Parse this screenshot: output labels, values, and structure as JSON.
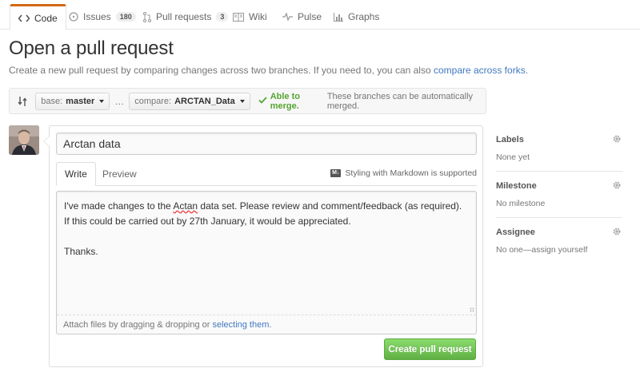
{
  "tabs": [
    {
      "label": "Code",
      "icon": "code-icon",
      "selected": true
    },
    {
      "label": "Issues",
      "icon": "issue-icon",
      "count": "180"
    },
    {
      "label": "Pull requests",
      "icon": "pull-request-icon",
      "count": "3"
    },
    {
      "label": "Wiki",
      "icon": "book-icon"
    },
    {
      "label": "Pulse",
      "icon": "pulse-icon"
    },
    {
      "label": "Graphs",
      "icon": "graph-icon"
    }
  ],
  "page": {
    "title": "Open a pull request",
    "subtitle": "Create a new pull request by comparing changes across two branches. If you need to, you can also ",
    "subtitle_link": "compare across forks",
    "subtitle_end": "."
  },
  "range": {
    "base_prefix": "base:",
    "base_branch": "master",
    "dots": "…",
    "compare_prefix": "compare:",
    "compare_branch": "ARCTAN_Data",
    "merge_ok": "Able to merge.",
    "merge_text": "These branches can be automatically merged."
  },
  "form": {
    "title_value": "Arctan data",
    "write_tab": "Write",
    "preview_tab": "Preview",
    "markdown_hint": "Styling with Markdown is supported",
    "markdown_badge": "M↓",
    "body_part1": "I've made changes to the ",
    "body_misspelled": "Actan",
    "body_part2": " data set. Please review and comment/feedback (as required). If this could be carried out by 27th January, it would be appreciated.\n\nThanks.",
    "attach_text": "Attach files by dragging & dropping or",
    "attach_link": "selecting them",
    "attach_end": ".",
    "submit_label": "Create pull request"
  },
  "sidebar": {
    "labels": {
      "heading": "Labels",
      "value": "None yet"
    },
    "milestone": {
      "heading": "Milestone",
      "value": "No milestone"
    },
    "assignee": {
      "heading": "Assignee",
      "value": "No one—assign yourself"
    }
  },
  "colors": {
    "accent_tab": "#d26911",
    "link": "#4078c0",
    "merge_ok": "#55a532",
    "button_green": "#60b044"
  }
}
